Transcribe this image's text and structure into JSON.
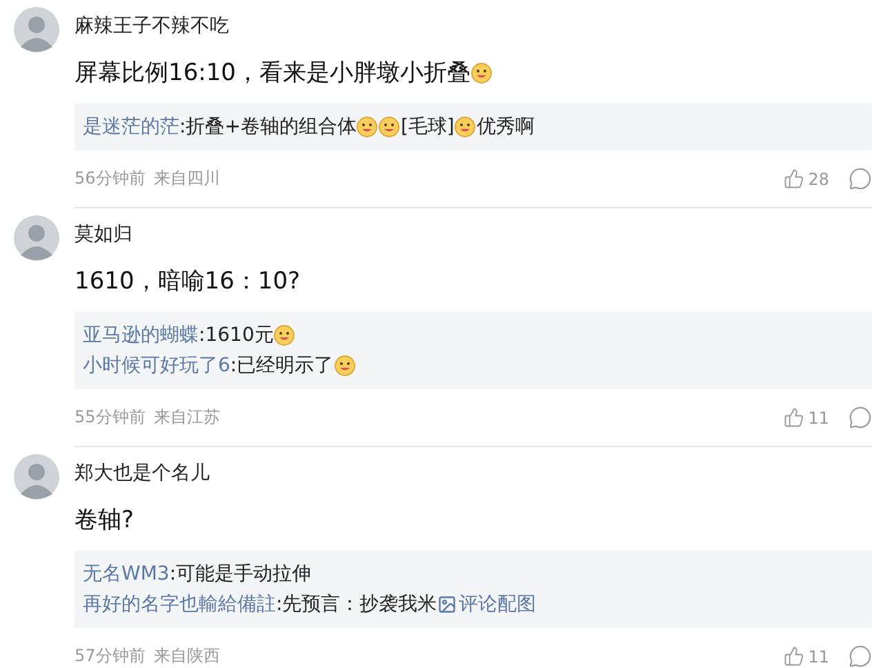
{
  "comments": [
    {
      "author": "麻辣王子不辣不吃",
      "body": [
        {
          "kind": "text",
          "text": "屏幕比例16:10，看来是小胖墩小折叠"
        },
        {
          "kind": "emoji"
        }
      ],
      "replies": [
        [
          {
            "kind": "user",
            "text": "是迷茫的茫"
          },
          {
            "kind": "text",
            "text": ":折叠+卷轴的组合体"
          },
          {
            "kind": "emoji"
          },
          {
            "kind": "emoji"
          },
          {
            "kind": "text",
            "text": "[毛球]"
          },
          {
            "kind": "emoji"
          },
          {
            "kind": "text",
            "text": "优秀啊"
          }
        ]
      ],
      "time": "56分钟前",
      "location": "来自四川",
      "likes": "28"
    },
    {
      "author": "莫如归",
      "body": [
        {
          "kind": "text",
          "text": "1610，暗喻16：10?"
        }
      ],
      "replies": [
        [
          {
            "kind": "user",
            "text": "亚马逊的蝴蝶"
          },
          {
            "kind": "text",
            "text": ":1610元"
          },
          {
            "kind": "emoji"
          }
        ],
        [
          {
            "kind": "user",
            "text": "小时候可好玩了6"
          },
          {
            "kind": "text",
            "text": ":已经明示了"
          },
          {
            "kind": "emoji"
          }
        ]
      ],
      "time": "55分钟前",
      "location": "来自江苏",
      "likes": "11"
    },
    {
      "author": "郑大也是个名儿",
      "body": [
        {
          "kind": "text",
          "text": "卷轴?"
        }
      ],
      "replies": [
        [
          {
            "kind": "user",
            "text": "无名WM3"
          },
          {
            "kind": "text",
            "text": ":可能是手动拉伸"
          }
        ],
        [
          {
            "kind": "user",
            "text": "再好的名字也輸給備註"
          },
          {
            "kind": "text",
            "text": ":先预言：抄袭我米 "
          },
          {
            "kind": "image_link",
            "text": "评论配图"
          }
        ]
      ],
      "time": "57分钟前",
      "location": "来自陕西",
      "likes": "11"
    }
  ]
}
